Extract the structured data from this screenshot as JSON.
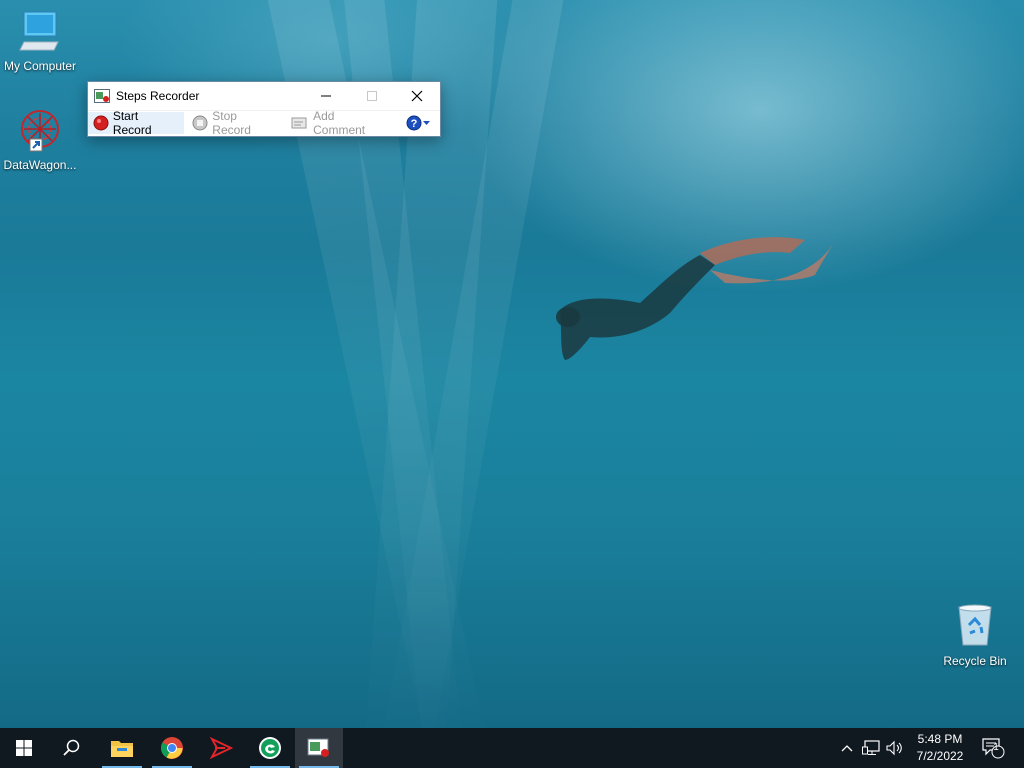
{
  "desktop": {
    "icons": [
      {
        "label": "My Computer",
        "icon": "monitor-icon"
      },
      {
        "label": "DataWagon...",
        "icon": "datawagon-icon"
      },
      {
        "label": "Recycle Bin",
        "icon": "recycle-bin-icon"
      }
    ]
  },
  "steps_recorder": {
    "title": "Steps Recorder",
    "start_record": "Start Record",
    "stop_record": "Stop Record",
    "add_comment": "Add Comment",
    "help_icon": "help-icon",
    "record_color": "#d42020",
    "help_color": "#1c4fbf"
  },
  "taskbar": {
    "apps": [
      {
        "name": "start-icon"
      },
      {
        "name": "search-icon"
      },
      {
        "name": "file-explorer-icon"
      },
      {
        "name": "chrome-icon"
      },
      {
        "name": "red-arrow-app-icon"
      },
      {
        "name": "green-circle-app-icon"
      },
      {
        "name": "steps-recorder-icon"
      }
    ],
    "clock": {
      "time": "5:48 PM",
      "date": "7/2/2022"
    },
    "notification_count": "1",
    "bg_color": "#101820",
    "accent": "#76b9ed"
  }
}
